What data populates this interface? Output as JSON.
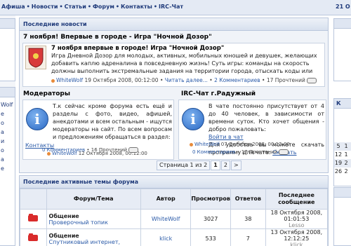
{
  "nav": {
    "items": [
      "Афиша",
      "Новости",
      "Статьи",
      "Форум",
      "Контакты",
      "IRC-Чат"
    ],
    "separator": "•",
    "date": "21 О"
  },
  "news": {
    "header": "Последние новости",
    "headline": "7 ноября! Впервые в городе - Игра \"Ночной Дозор\"",
    "title": "7 ноября впервые в городе! Игра \"Ночной Дозор\"",
    "body": "Игра Дневной Дозор для молодых, активных, мобильных юношей и девушек, желающих добавить каплю адреналина в повседневную жизнь! Суть игры: команды на скорость должны выполнить экстремальные задания на территории города, отыскать коды или предметы и передать их в штаб.",
    "author": "WhiteWolf",
    "date": "19 Октября 2008, 00:12:00",
    "more": "Читать далее...",
    "comments": "2 Комментариев",
    "reads": "17 Прочтений"
  },
  "moderators": {
    "title": "Модераторы",
    "body": "Т.к сейчас кроме форума есть ещё и разделы с фото, видео, афишей, анекдотами и всем остальным - ищутся модераторы на сайт. По всем вопросам и предложениям обращаться в раздел:",
    "link": "Контакты",
    "author": "WhiteWolf",
    "date": "12 Октября 2008, 00:12:00",
    "comments": "0 Комментариев",
    "reads": "16 Прочтений"
  },
  "irc": {
    "title": "IRC-Чат г.Радужный",
    "body1": "В чате постоянно присутствует от 4 до 40 человек, в зависимости от времени суток. Кто хочет общения - добро пожаловать:",
    "link1": "Войти в чат",
    "body2": "Для удобства вы можете скачать программу для чата:",
    "link2": "Скачать",
    "author": "WhiteWolf",
    "date": "07 Октября 2008, 00:12:00",
    "comments": "0 Комментариев",
    "reads": "17 Прочтений"
  },
  "pager": {
    "label": "Страница 1 из 2",
    "p1": "1",
    "p2": "2",
    "next": ">"
  },
  "forum": {
    "header": "Последние активные темы форума",
    "columns": [
      "Форум/Тема",
      "Автор",
      "Просмотров",
      "Ответов",
      "Последнее сообщение"
    ],
    "rows": [
      {
        "forum": "Общение",
        "topic": "Проверочный топик",
        "author": "WhiteWolf",
        "views": "3027",
        "replies": "38",
        "last_date": "18 Октября 2008,",
        "last_time": "01:01:53",
        "last_user": "Lesso"
      },
      {
        "forum": "Общение",
        "topic": "Спутниковый интернет,",
        "author": "klick",
        "views": "533",
        "replies": "7",
        "last_date": "13 Октября 2008,",
        "last_time": "12:12:25",
        "last_user": "klick"
      }
    ]
  },
  "right": {
    "box1_title": "",
    "box2_title": "К",
    "numbers": [
      [
        "5",
        "1"
      ],
      [
        "12",
        "1"
      ],
      [
        "19",
        "2"
      ],
      [
        "26",
        "2"
      ]
    ]
  },
  "left": {
    "items": [
      "Wolf",
      "е",
      "о",
      "а",
      "и",
      "о",
      "а",
      "е"
    ]
  }
}
